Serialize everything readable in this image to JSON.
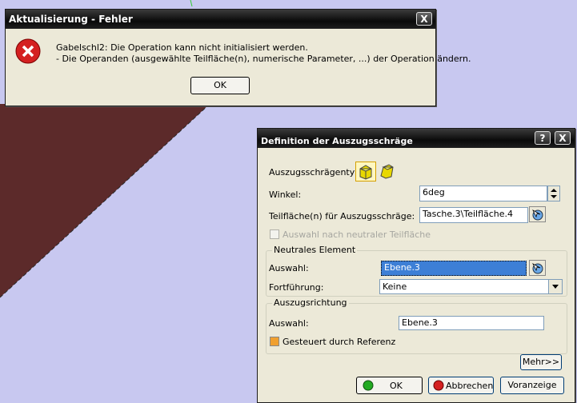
{
  "error_dialog": {
    "title": "Aktualisierung - Fehler",
    "message_line1": "Gabelschl2: Die Operation kann nicht initialisiert werden.",
    "message_line2": " - Die Operanden (ausgewählte Teilfläche(n), numerische Parameter, ...) der Operation ändern.",
    "ok_label": "OK",
    "close_label": "X"
  },
  "draft_dialog": {
    "title": "Definition der Auszugsschräge",
    "help_label": "?",
    "close_label": "X",
    "draft_type_label": "Auszugsschrägentyp:",
    "angle_label": "Winkel:",
    "angle_value": "6deg",
    "faces_label": "Teilfläche(n) für Auszugsschräge:",
    "faces_value": "Tasche.3\\Teilfläche.4",
    "neutral_checkbox_label": "Auswahl nach neutraler Teilfläche",
    "neutral_group": {
      "title": "Neutrales Element",
      "selection_label": "Auswahl:",
      "selection_value": "Ebene.3",
      "propagation_label": "Fortführung:",
      "propagation_value": "Keine"
    },
    "pulling_group": {
      "title": "Auszugsrichtung",
      "selection_label": "Auswahl:",
      "selection_value": "Ebene.3",
      "controlled_label": "Gesteuert durch Referenz"
    },
    "more_label": "Mehr>>",
    "ok_label": "OK",
    "cancel_label": "Abbrechen",
    "preview_label": "Voranzeige"
  },
  "colors": {
    "background": "#c8c8f0",
    "solid_part": "#5c2a2a",
    "selection_highlight": "#3d7fd6"
  },
  "icons": [
    "error-icon",
    "draft-constant-icon",
    "draft-variable-icon",
    "face-select-icon",
    "spin-up-icon",
    "spin-down-icon",
    "dropdown-arrow-icon",
    "ok-green-icon",
    "cancel-red-icon"
  ]
}
